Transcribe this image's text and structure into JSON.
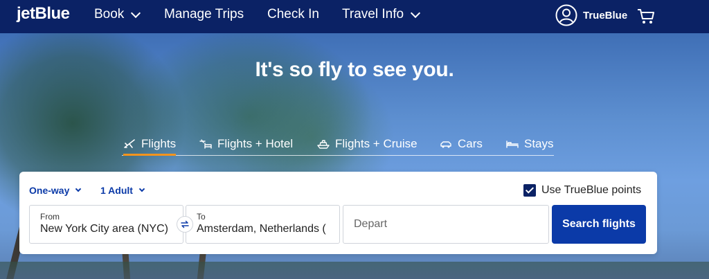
{
  "nav": {
    "logo": "jetBlue",
    "items": [
      {
        "label": "Book",
        "dropdown": true
      },
      {
        "label": "Manage Trips",
        "dropdown": false
      },
      {
        "label": "Check In",
        "dropdown": false
      },
      {
        "label": "Travel Info",
        "dropdown": true
      }
    ],
    "trueblue_label": "TrueBlue",
    "icons": [
      "user-icon",
      "cart-icon"
    ]
  },
  "hero": {
    "headline": "It's so fly to see you."
  },
  "tabs": [
    {
      "label": "Flights",
      "icon": "plane-icon",
      "active": true
    },
    {
      "label": "Flights + Hotel",
      "icon": "plane-bed-icon",
      "active": false
    },
    {
      "label": "Flights + Cruise",
      "icon": "ship-icon",
      "active": false
    },
    {
      "label": "Cars",
      "icon": "car-icon",
      "active": false
    },
    {
      "label": "Stays",
      "icon": "bed-icon",
      "active": false
    }
  ],
  "booking": {
    "trip_type": "One-way",
    "passengers": "1 Adult",
    "use_points_label": "Use TrueBlue points",
    "use_points_checked": true,
    "from_label": "From",
    "from_value": "New York City area (NYC)",
    "to_label": "To",
    "to_value": "Amsterdam, Netherlands (",
    "depart_placeholder": "Depart",
    "search_label": "Search flights"
  },
  "colors": {
    "nav_bg": "#0b2265",
    "accent_orange": "#f7941d",
    "button_blue": "#0b3aa8"
  }
}
